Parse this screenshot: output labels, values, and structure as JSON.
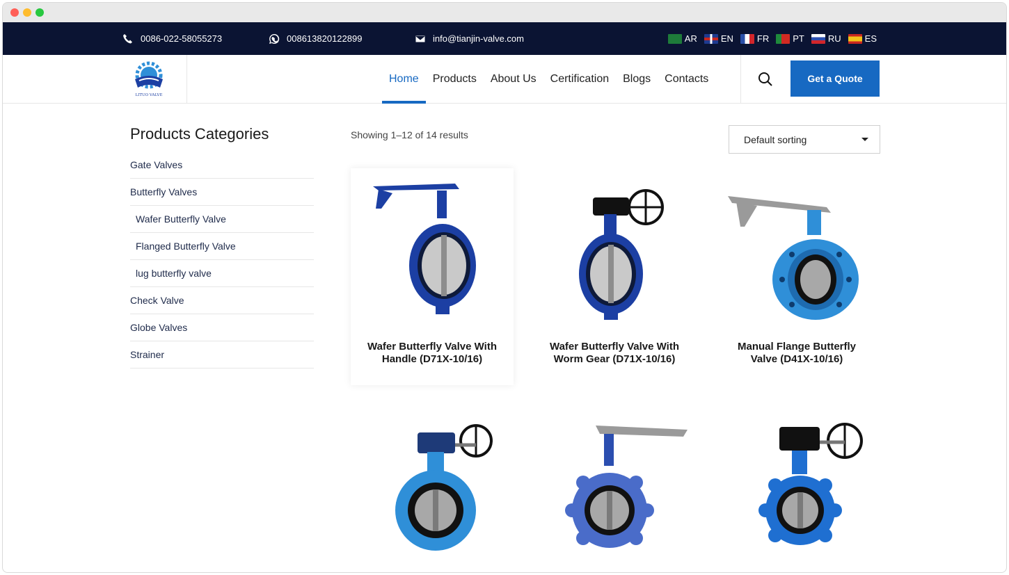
{
  "topbar": {
    "phone": "0086-022-58055273",
    "whatsapp": "008613820122899",
    "email": "info@tianjin-valve.com",
    "languages": [
      {
        "code": "AR",
        "flag_color": "#1e7b3a"
      },
      {
        "code": "EN",
        "flag_color": "#1f3b8f"
      },
      {
        "code": "FR",
        "flag_color": "#2a4fa8"
      },
      {
        "code": "PT",
        "flag_color": "#1f8a3c"
      },
      {
        "code": "RU",
        "flag_color": "#2b4eb0"
      },
      {
        "code": "ES",
        "flag_color": "#c8261f"
      }
    ]
  },
  "header": {
    "logo_text": "LITUO VALVE",
    "nav": [
      "Home",
      "Products",
      "About Us",
      "Certification",
      "Blogs",
      "Contacts"
    ],
    "active_nav": "Home",
    "quote_label": "Get a Quote"
  },
  "sidebar": {
    "title": "Products Categories",
    "items": [
      "Gate Valves",
      "Butterfly Valves",
      "Wafer Butterfly Valve",
      "Flanged Butterfly Valve",
      "lug butterfly valve",
      "Check Valve",
      "Globe Valves",
      "Strainer"
    ]
  },
  "shop": {
    "results_text": "Showing 1–12 of 14 results",
    "sort_label": "Default sorting",
    "products": [
      {
        "title_line1": "Wafer Butterfly Valve With",
        "title_line2": "Handle (D71X-10/16)"
      },
      {
        "title_line1": "Wafer Butterfly Valve With",
        "title_line2": "Worm Gear (D71X-10/16)"
      },
      {
        "title_line1": "Manual Flange Butterfly",
        "title_line2": "Valve (D41X-10/16)"
      },
      {
        "title_line1": "",
        "title_line2": ""
      },
      {
        "title_line1": "",
        "title_line2": ""
      },
      {
        "title_line1": "",
        "title_line2": ""
      }
    ]
  },
  "colors": {
    "accent": "#1769c2",
    "topbar_bg": "#0b1433",
    "valve_dark_blue": "#1c3fa3",
    "valve_light_blue": "#2f8fd8"
  }
}
